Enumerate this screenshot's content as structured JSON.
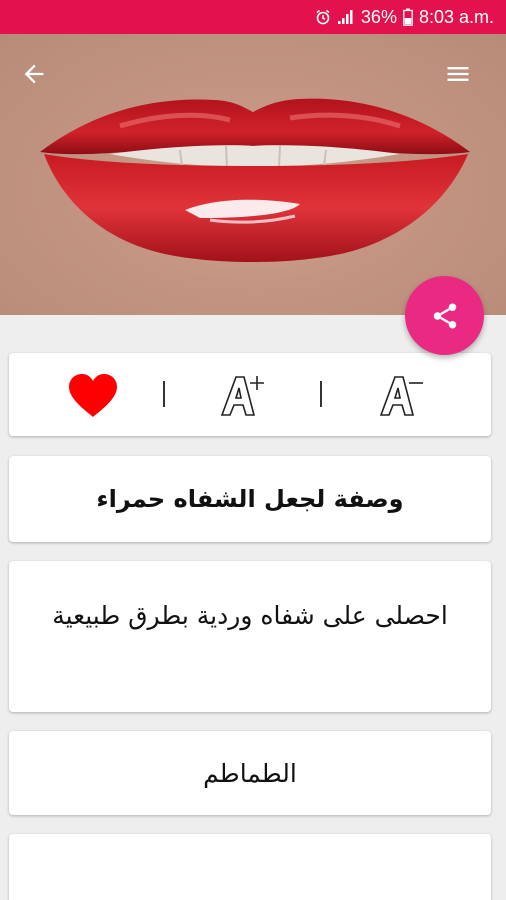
{
  "status_bar": {
    "battery_percent": "36%",
    "time": "8:03 a.m.",
    "background": "#e3124f"
  },
  "toolbar": {
    "back_icon": "arrow-left-icon",
    "menu_icon": "hamburger-menu-icon"
  },
  "fab": {
    "icon": "share-icon",
    "color": "#ea2a82"
  },
  "actions": {
    "favorite_icon": "heart-icon",
    "favorite_color": "#ff0000",
    "font_increase_icon": "font-increase-icon",
    "font_decrease_icon": "font-decrease-icon"
  },
  "article": {
    "title": "وصفة لجعل الشفاه حمراء",
    "subtitle": "احصلى على شفاه وردية بطرق طبيعية",
    "item": "الطماطم"
  }
}
